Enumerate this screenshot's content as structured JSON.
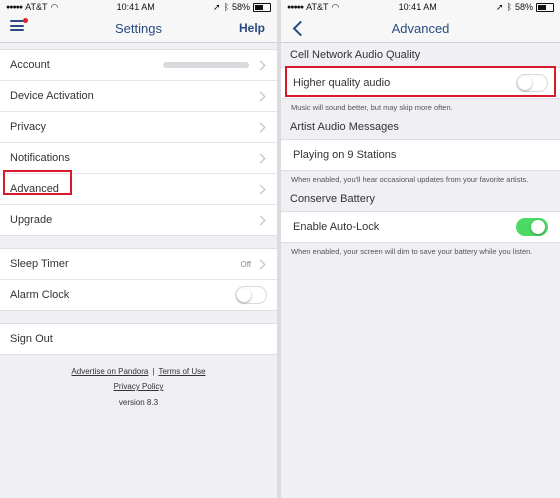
{
  "left": {
    "status": {
      "carrier": "AT&T",
      "time": "10:41 AM",
      "battery": "58%"
    },
    "nav": {
      "title": "Settings",
      "help": "Help"
    },
    "group1": [
      {
        "label": "Account",
        "value": ""
      },
      {
        "label": "Device Activation"
      },
      {
        "label": "Privacy"
      },
      {
        "label": "Notifications"
      },
      {
        "label": "Advanced"
      },
      {
        "label": "Upgrade"
      }
    ],
    "group2": [
      {
        "label": "Sleep Timer",
        "value": "Off"
      },
      {
        "label": "Alarm Clock",
        "toggle_on": false
      }
    ],
    "signout": "Sign Out",
    "footer": {
      "advertise": "Advertise on Pandora",
      "terms": "Terms of Use",
      "privacy": "Privacy Policy",
      "version": "version 8.3"
    }
  },
  "right": {
    "status": {
      "carrier": "AT&T",
      "time": "10:41 AM",
      "battery": "58%"
    },
    "nav": {
      "title": "Advanced"
    },
    "cell": {
      "header": "Cell Network Audio Quality",
      "row": "Higher quality audio",
      "toggle_on": false,
      "desc": "Music will sound better, but may skip more often."
    },
    "artist": {
      "header": "Artist Audio Messages",
      "row": "Playing on 9 Stations",
      "desc": "When enabled, you'll hear occasional updates from your favorite artists."
    },
    "battery": {
      "header": "Conserve Battery",
      "row": "Enable Auto-Lock",
      "toggle_on": true,
      "desc": "When enabled, your screen will dim to save your battery while you listen."
    }
  },
  "colors": {
    "accent": "#2b4a82",
    "toggle_on": "#4cd964",
    "highlight": "#d9192c"
  }
}
